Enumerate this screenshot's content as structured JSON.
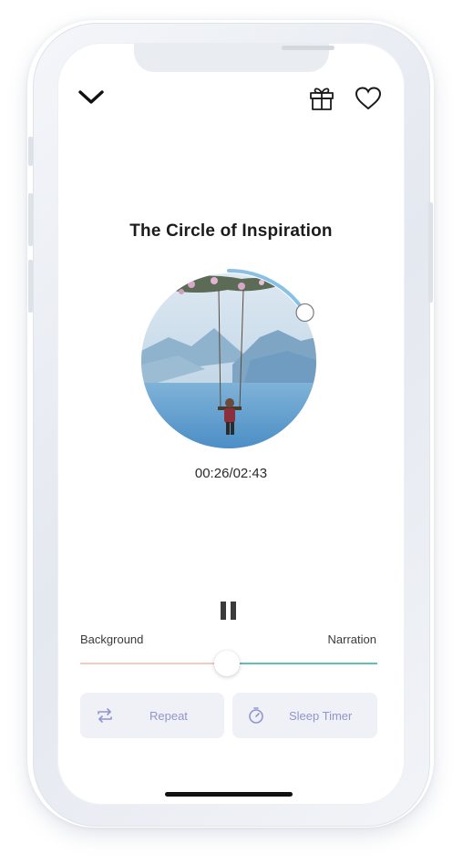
{
  "header": {
    "collapse_icon": "chevron-down-icon",
    "gift_icon": "gift-icon",
    "favorite_icon": "heart-icon"
  },
  "player": {
    "title": "The Circle of Inspiration",
    "elapsed": "00:26",
    "duration": "02:43",
    "time_display": "00:26/02:43",
    "progress_fraction": 0.16,
    "state": "playing",
    "pause_icon": "pause-icon"
  },
  "mix": {
    "left_label": "Background",
    "right_label": "Narration",
    "balance_fraction": 0.5,
    "left_color": "#f2c9c3",
    "right_color": "#5fc1b6"
  },
  "actions": {
    "repeat_label": "Repeat",
    "repeat_icon": "repeat-icon",
    "sleep_label": "Sleep Timer",
    "sleep_icon": "timer-icon"
  },
  "colors": {
    "accent": "#8f96ce",
    "ring_gradient_start": "#b9a4e8",
    "ring_gradient_end": "#7fc6e6"
  }
}
